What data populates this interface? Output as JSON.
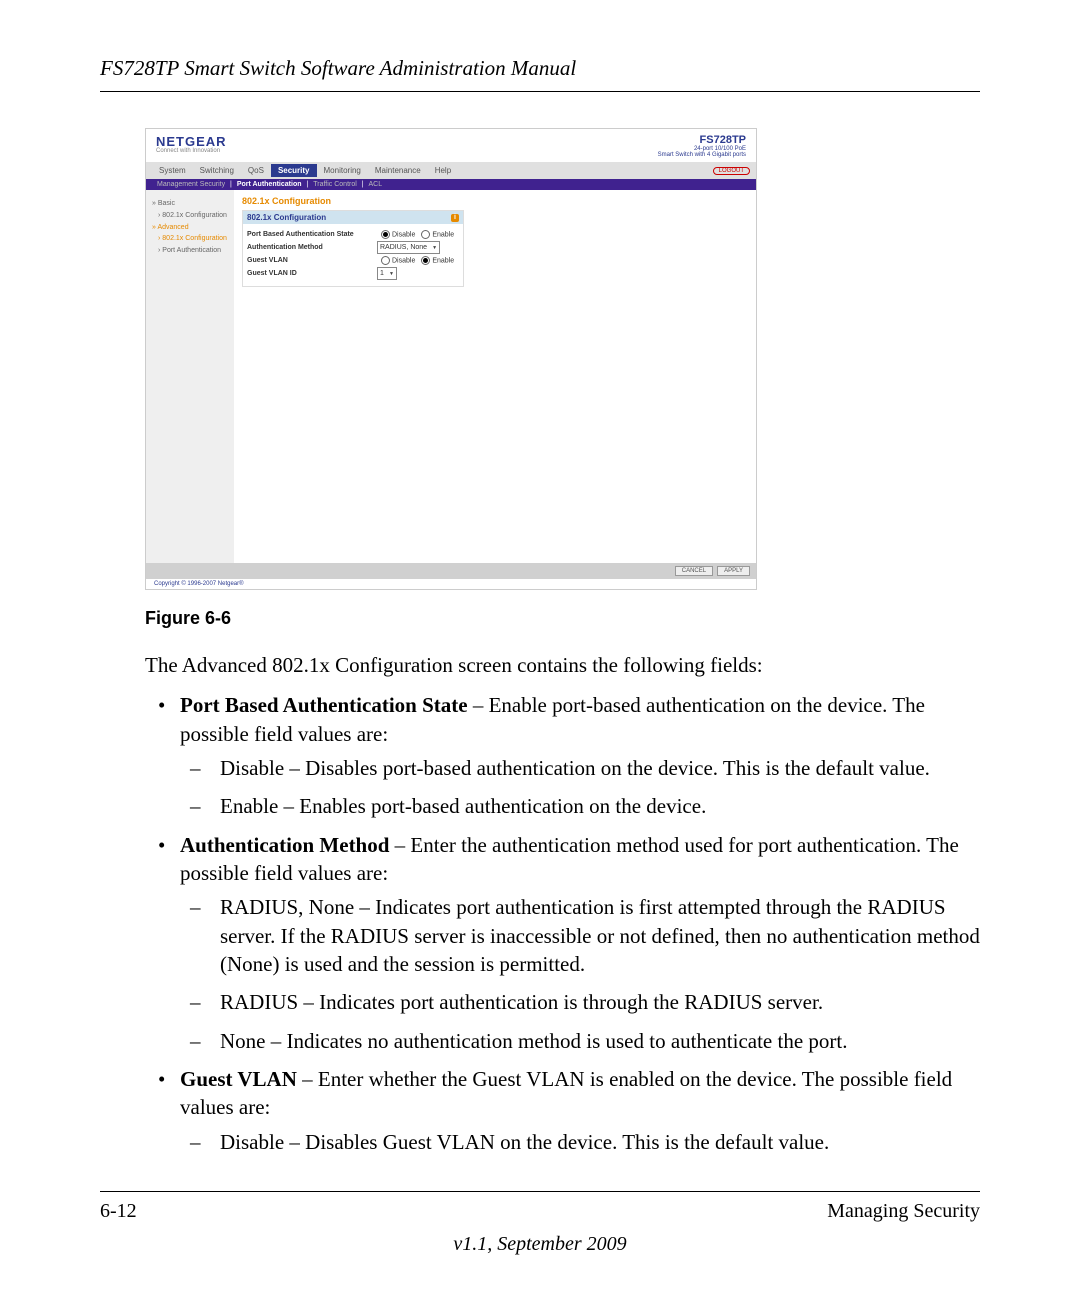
{
  "header": {
    "title": "FS728TP Smart Switch Software Administration Manual"
  },
  "screenshot": {
    "brand": "NETGEAR",
    "tagline": "Connect with Innovation",
    "model": "FS728TP",
    "model_sub1": "24-port 10/100 PoE",
    "model_sub2": "Smart Switch with 4 Gigabit ports",
    "logout": "LOGOUT",
    "tabs": [
      "System",
      "Switching",
      "QoS",
      "Security",
      "Monitoring",
      "Maintenance",
      "Help"
    ],
    "tabs_active": 3,
    "subtabs": [
      "Management Security",
      "Port Authentication",
      "Traffic Control",
      "ACL"
    ],
    "subtabs_active": 1,
    "sidebar": [
      {
        "label": "Basic",
        "cls": ""
      },
      {
        "label": "802.1x Configuration",
        "cls": "sub"
      },
      {
        "label": "Advanced",
        "cls": "sel"
      },
      {
        "label": "802.1x Configuration",
        "cls": "sub sel"
      },
      {
        "label": "Port Authentication",
        "cls": "sub"
      }
    ],
    "section_title": "802.1x Configuration",
    "panel_title": "802.1x Configuration",
    "rows": {
      "r1": {
        "label": "Port Based Authentication State",
        "disable": "Disable",
        "enable": "Enable"
      },
      "r2": {
        "label": "Authentication Method",
        "select": "RADIUS, None"
      },
      "r3": {
        "label": "Guest VLAN",
        "disable": "Disable",
        "enable": "Enable"
      },
      "r4": {
        "label": "Guest VLAN ID",
        "select": "1"
      }
    },
    "buttons": {
      "cancel": "CANCEL",
      "apply": "APPLY"
    },
    "copyright": "Copyright © 1996-2007 Netgear®"
  },
  "figure_caption": "Figure 6-6",
  "intro": "The Advanced 802.1x Configuration screen contains the following fields:",
  "bullets": [
    {
      "lead": "Port Based Authentication State",
      "rest": " – Enable port-based authentication on the device. The possible field values are:",
      "subs": [
        "Disable – Disables port-based authentication on the device. This is the default value.",
        "Enable – Enables port-based authentication on the device."
      ]
    },
    {
      "lead": "Authentication Method",
      "rest": " – Enter the authentication method used for port authentication. The possible field values are:",
      "subs": [
        "RADIUS, None – Indicates port authentication is first attempted through the RADIUS server. If the RADIUS server is inaccessible or not defined, then no authentication method (None) is used and the session is permitted.",
        "RADIUS – Indicates port authentication is through the RADIUS server.",
        "None – Indicates no authentication method is used to authenticate the port."
      ]
    },
    {
      "lead": "Guest VLAN",
      "rest": " – Enter whether the Guest VLAN is enabled on the device. The possible field values are:",
      "subs": [
        "Disable – Disables Guest VLAN on the device. This is the default value."
      ]
    }
  ],
  "footer": {
    "left": "6-12",
    "right": "Managing Security",
    "version": "v1.1, September 2009"
  }
}
